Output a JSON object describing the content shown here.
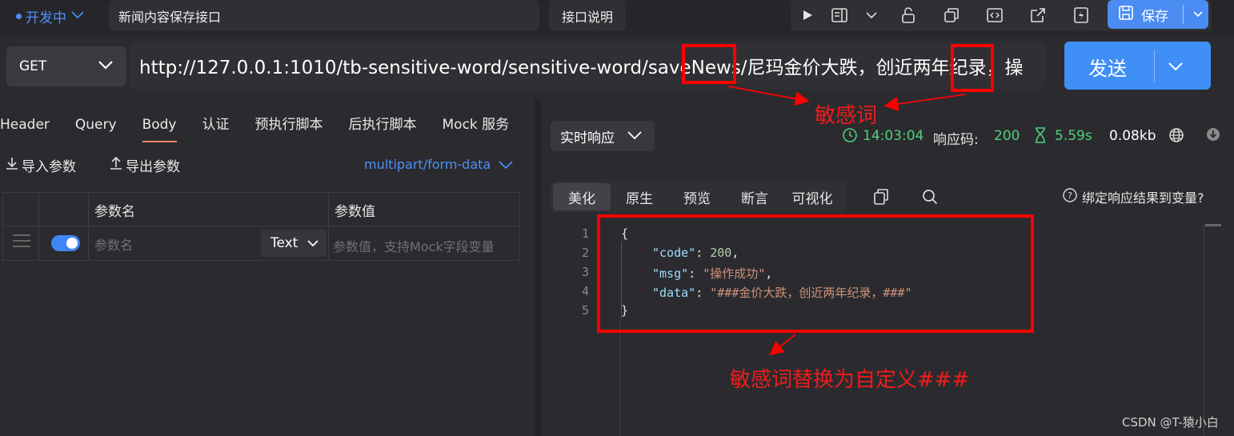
{
  "topbar": {
    "status": "开发中",
    "api_name": "新闻内容保存接口",
    "api_doc": "接口说明",
    "save": "保存"
  },
  "request": {
    "method": "GET",
    "url": "http://127.0.0.1:1010/tb-sensitive-word/sensitive-word/saveNews/尼玛金价大跌，创近两年纪录，操",
    "send": "发送"
  },
  "left_tabs": [
    "Header",
    "Query",
    "Body",
    "认证",
    "预执行脚本",
    "后执行脚本",
    "Mock 服务"
  ],
  "params": {
    "import": "导入参数",
    "export": "导出参数",
    "content_type": "multipart/form-data",
    "col_name": "参数名",
    "col_value": "参数值",
    "name_placeholder": "参数名",
    "type": "Text",
    "value_placeholder": "参数值，支持Mock字段变量"
  },
  "response": {
    "mode": "实时响应",
    "time": "14:03:04",
    "code_label": "响应码:",
    "code": "200",
    "duration": "5.59s",
    "size": "0.08kb",
    "tabs": [
      "美化",
      "原生",
      "预览",
      "断言",
      "可视化"
    ],
    "bind": "绑定响应结果到变量?",
    "lines": [
      "1",
      "2",
      "3",
      "4",
      "5"
    ],
    "json": {
      "open": "{",
      "code_key": "\"code\"",
      "code_val": "200",
      "msg_key": "\"msg\"",
      "msg_val": "\"操作成功\"",
      "data_key": "\"data\"",
      "data_val": "\"###金价大跌，创近两年纪录，###\"",
      "close": "}"
    }
  },
  "annotations": {
    "sensitive": "敏感词",
    "replaced": "敏感词替换为自定义###"
  },
  "watermark": "CSDN @T-猿小白",
  "colors": {
    "accent": "#4e8ff7",
    "annotation": "#ff0000",
    "success": "#4fcf7b"
  }
}
